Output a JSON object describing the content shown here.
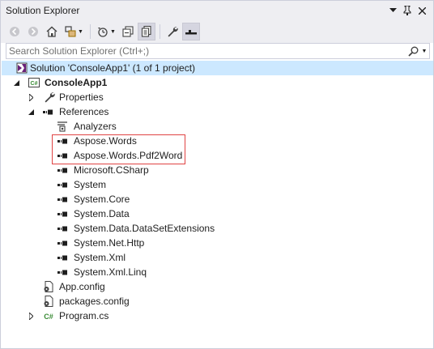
{
  "window": {
    "title": "Solution Explorer",
    "title_buttons": [
      "dropdown-arrow-icon",
      "pin-icon",
      "close-icon"
    ]
  },
  "toolbar": {
    "buttons": [
      "back-icon",
      "forward-icon",
      "home-icon",
      "switch-views-icon",
      "pending-changes-filter-icon",
      "collapse-all-icon",
      "show-all-files-icon",
      "properties-icon",
      "preview-selected-icon"
    ]
  },
  "search": {
    "placeholder": "Search Solution Explorer (Ctrl+;)"
  },
  "tree": {
    "solution": "Solution 'ConsoleApp1' (1 of 1 project)",
    "project": "ConsoleApp1",
    "properties": "Properties",
    "references": "References",
    "ref_items": [
      "Analyzers",
      "Aspose.Words",
      "Aspose.Words.Pdf2Word",
      "Microsoft.CSharp",
      "System",
      "System.Core",
      "System.Data",
      "System.Data.DataSetExtensions",
      "System.Net.Http",
      "System.Xml",
      "System.Xml.Linq"
    ],
    "files": [
      "App.config",
      "packages.config",
      "Program.cs"
    ]
  },
  "colors": {
    "selection": "#cce8ff",
    "highlight_border": "#e04343",
    "chrome_bg": "#eeeef2",
    "csharp_green": "#388a34",
    "solution_purple": "#68217a"
  }
}
